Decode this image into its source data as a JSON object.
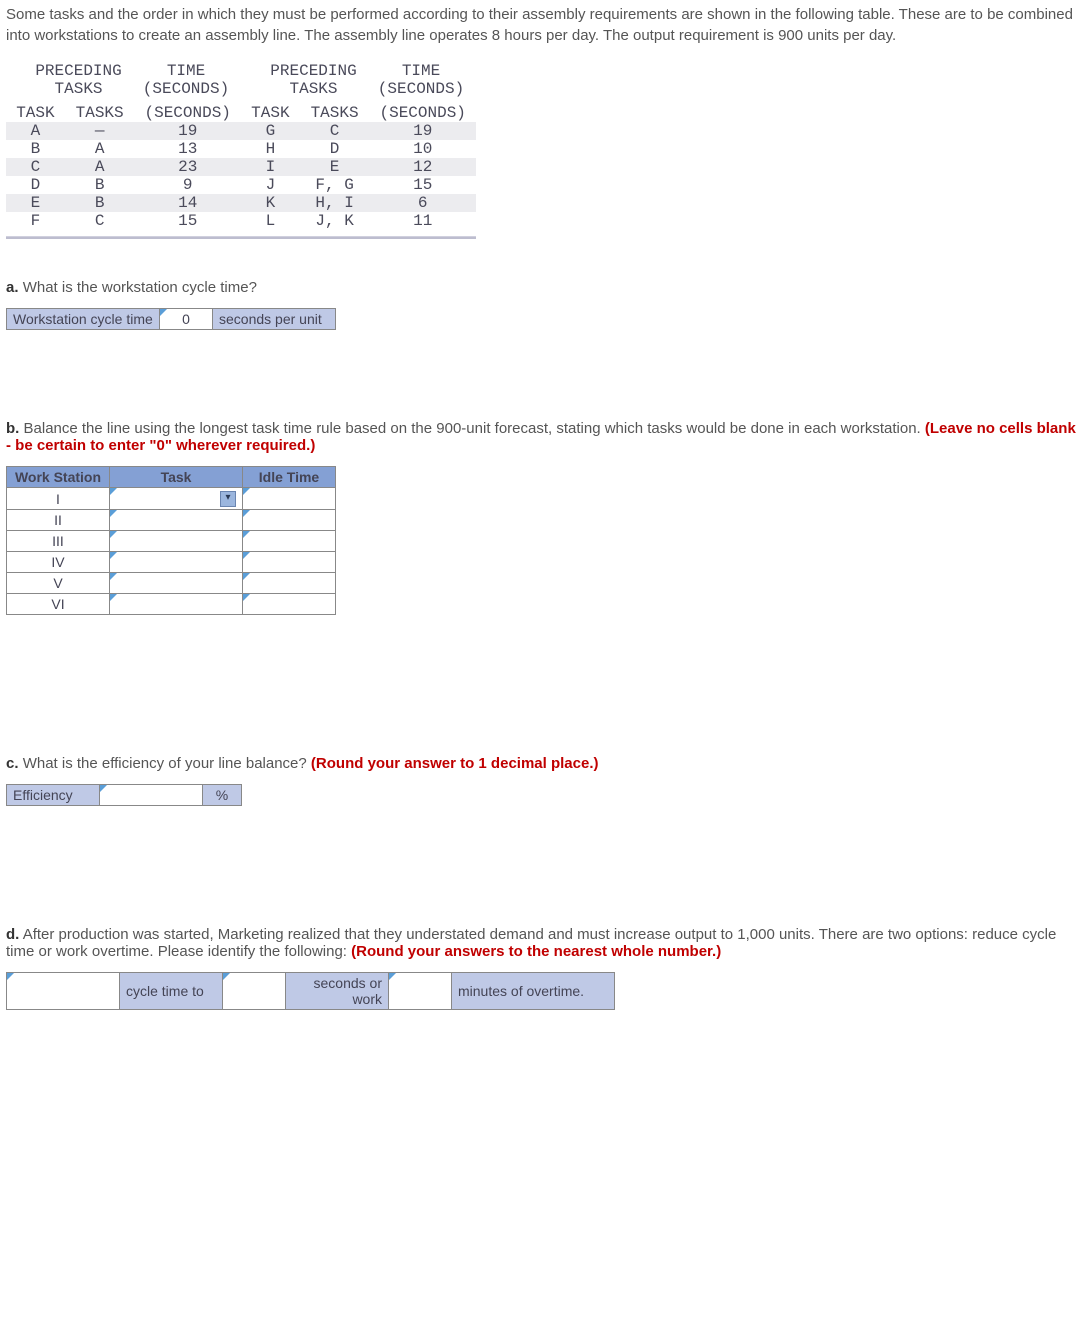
{
  "intro": "Some tasks and the order in which they must be performed according to their assembly requirements are shown in the following table. These are to be combined into workstations to create an assembly line. The assembly line operates 8 hours per day. The output requirement is 900 units per day.",
  "tasks_header": {
    "task": "TASK",
    "preceding": "PRECEDING TASKS",
    "time": "TIME (SECONDS)"
  },
  "tasks_left": [
    {
      "task": "A",
      "prec": "—",
      "time": "19"
    },
    {
      "task": "B",
      "prec": "A",
      "time": "13"
    },
    {
      "task": "C",
      "prec": "A",
      "time": "23"
    },
    {
      "task": "D",
      "prec": "B",
      "time": "9"
    },
    {
      "task": "E",
      "prec": "B",
      "time": "14"
    },
    {
      "task": "F",
      "prec": "C",
      "time": "15"
    }
  ],
  "tasks_right": [
    {
      "task": "G",
      "prec": "C",
      "time": "19"
    },
    {
      "task": "H",
      "prec": "D",
      "time": "10"
    },
    {
      "task": "I",
      "prec": "E",
      "time": "12"
    },
    {
      "task": "J",
      "prec": "F, G",
      "time": "15"
    },
    {
      "task": "K",
      "prec": "H, I",
      "time": "6"
    },
    {
      "task": "L",
      "prec": "J, K",
      "time": "11"
    }
  ],
  "a": {
    "label": "a.",
    "q": "What is the workstation cycle time?",
    "row_label": "Workstation cycle time",
    "value": "0",
    "unit": "seconds per unit"
  },
  "b": {
    "label": "b.",
    "q": "Balance the line using the longest task time rule based on the 900-unit forecast, stating which tasks would be done in each workstation.",
    "note": "(Leave no cells blank - be certain to enter \"0\" wherever required.)",
    "h1": "Work Station",
    "h2": "Task",
    "h3": "Idle Time",
    "rows": [
      "I",
      "II",
      "III",
      "IV",
      "V",
      "VI"
    ]
  },
  "c": {
    "label": "c.",
    "q": "What is the efficiency of your line balance?",
    "note": "(Round your answer to 1 decimal place.)",
    "row_label": "Efficiency",
    "unit": "%"
  },
  "d": {
    "label": "d.",
    "q": "After production was started, Marketing realized that they understated demand and must increase output to 1,000 units. There are two options: reduce cycle time or work overtime. Please identify the following:",
    "note": "(Round your answers to the nearest whole number.)",
    "c1": "cycle time to",
    "c2": "seconds or work",
    "c3": "minutes of overtime."
  }
}
